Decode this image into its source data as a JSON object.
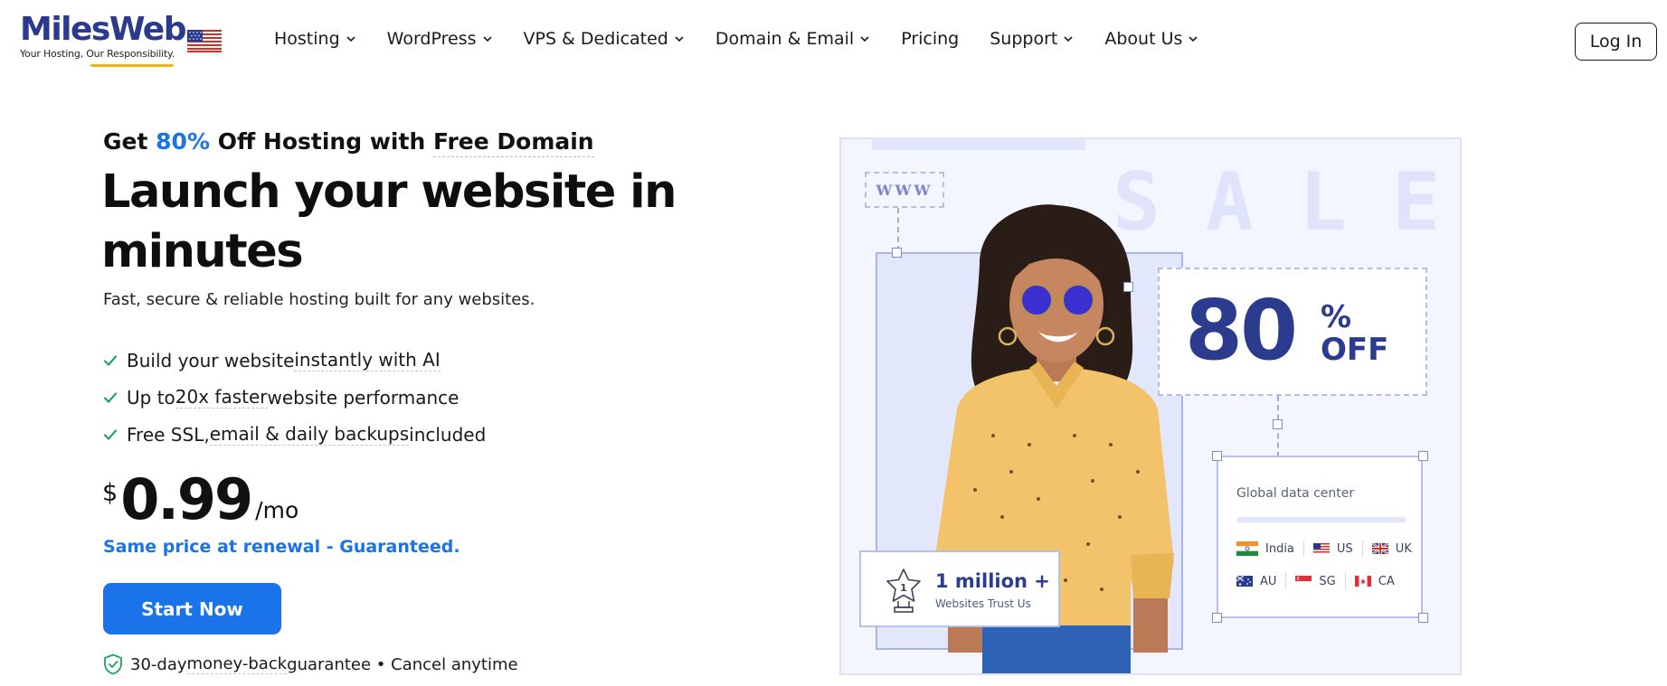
{
  "brand": {
    "name": "MilesWeb",
    "tagline": "Your Hosting, Our Responsibility."
  },
  "nav": {
    "items": [
      {
        "label": "Hosting",
        "dropdown": true
      },
      {
        "label": "WordPress",
        "dropdown": true
      },
      {
        "label": "VPS & Dedicated",
        "dropdown": true
      },
      {
        "label": "Domain & Email",
        "dropdown": true
      },
      {
        "label": "Pricing",
        "dropdown": false
      },
      {
        "label": "Support",
        "dropdown": true
      },
      {
        "label": "About Us",
        "dropdown": true
      }
    ],
    "login_label": "Log In"
  },
  "hero": {
    "promo_get": "Get",
    "promo_percent": "80%",
    "promo_mid": "Off Hosting with",
    "promo_domain": "Free Domain",
    "headline": "Launch your website in minutes",
    "subhead": "Fast, secure & reliable hosting built for any websites.",
    "features": [
      {
        "pre": "Build your website ",
        "dotted": "instantly with AI",
        "post": ""
      },
      {
        "pre": "Up to ",
        "dotted": "20x faster",
        "post": " website performance"
      },
      {
        "pre": "Free SSL, ",
        "dotted": "email & daily backups",
        "post": " included"
      }
    ],
    "price_currency": "$",
    "price_amount": "0.99",
    "price_period": "/mo",
    "renewal": "Same price at renewal - Guaranteed.",
    "cta_label": "Start Now",
    "guarantee_pre": "30-day ",
    "guarantee_dotted": "money-back",
    "guarantee_post": " guarantee • Cancel anytime"
  },
  "art": {
    "www": "WWW",
    "sale": "SALE",
    "off_number": "80",
    "off_percent": "%",
    "off_word": "OFF",
    "dc_title": "Global data center",
    "dc_row1": [
      "India",
      "US",
      "UK"
    ],
    "dc_row2": [
      "AU",
      "SG",
      "CA"
    ],
    "trust_big": "1 million +",
    "trust_small": "Websites Trust Us",
    "trust_badge_number": "1"
  },
  "colors": {
    "accent": "#1a73e8",
    "brand_navy": "#2b3c8f",
    "check_green": "#22a45d",
    "logo_underline": "#f2b705"
  }
}
